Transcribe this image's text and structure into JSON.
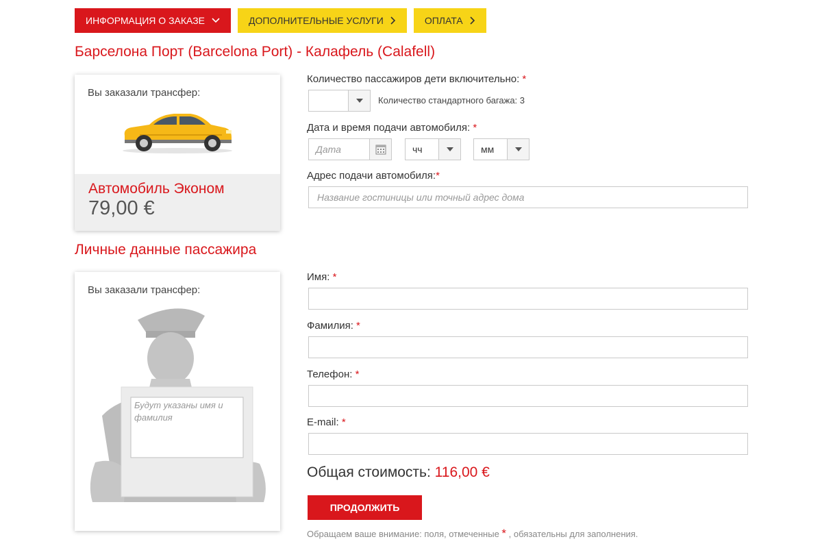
{
  "tabs": [
    {
      "label": "ИНФОРМАЦИЯ О ЗАКАЗЕ",
      "active": true
    },
    {
      "label": "ДОПОЛНИТЕЛЬНЫЕ УСЛУГИ",
      "active": false
    },
    {
      "label": "ОПЛАТА",
      "active": false
    }
  ],
  "route_title": "Барселона Порт (Barcelona Port) - Калафель (Calafell)",
  "vehicle_card": {
    "label": "Вы заказали трансфер:",
    "vehicle_name": "Автомобиль Эконом",
    "price": "79,00 €"
  },
  "booking": {
    "passengers_label": "Количество пассажиров дети включительно:",
    "passengers_value": "",
    "baggage_text": "Количество стандартного багажа: 3",
    "datetime_label": "Дата и время подачи автомобиля:",
    "date_placeholder": "Дата",
    "hour_value": "чч",
    "minute_value": "мм",
    "address_label": "Адрес подачи автомобиля:",
    "address_placeholder": "Название гостиницы или точный адрес дома",
    "required_mark": "*"
  },
  "personal_title": "Личные данные пассажира",
  "driver_card": {
    "label": "Вы заказали трансфер:",
    "sign_text": "Будут указаны имя и фамилия"
  },
  "personal": {
    "first_name_label": "Имя:",
    "last_name_label": "Фамилия:",
    "phone_label": "Телефон:",
    "email_label": "E-mail:"
  },
  "total": {
    "label": "Общая стоимость:",
    "amount": "116,00 €"
  },
  "continue_label": "ПРОДОЛЖИТЬ",
  "note": {
    "before": "Обращаем ваше внимание: поля, отмеченные",
    "mark": "*",
    "after": ", обязательны для заполнения."
  },
  "colors": {
    "accent_red": "#d9171c",
    "tab_yellow": "#f7d417",
    "car_yellow": "#f6b817"
  },
  "icons": [
    "chevron-down-icon",
    "chevron-right-icon",
    "calendar-icon",
    "dropdown-arrow-icon",
    "car-icon",
    "driver-silhouette-icon"
  ]
}
